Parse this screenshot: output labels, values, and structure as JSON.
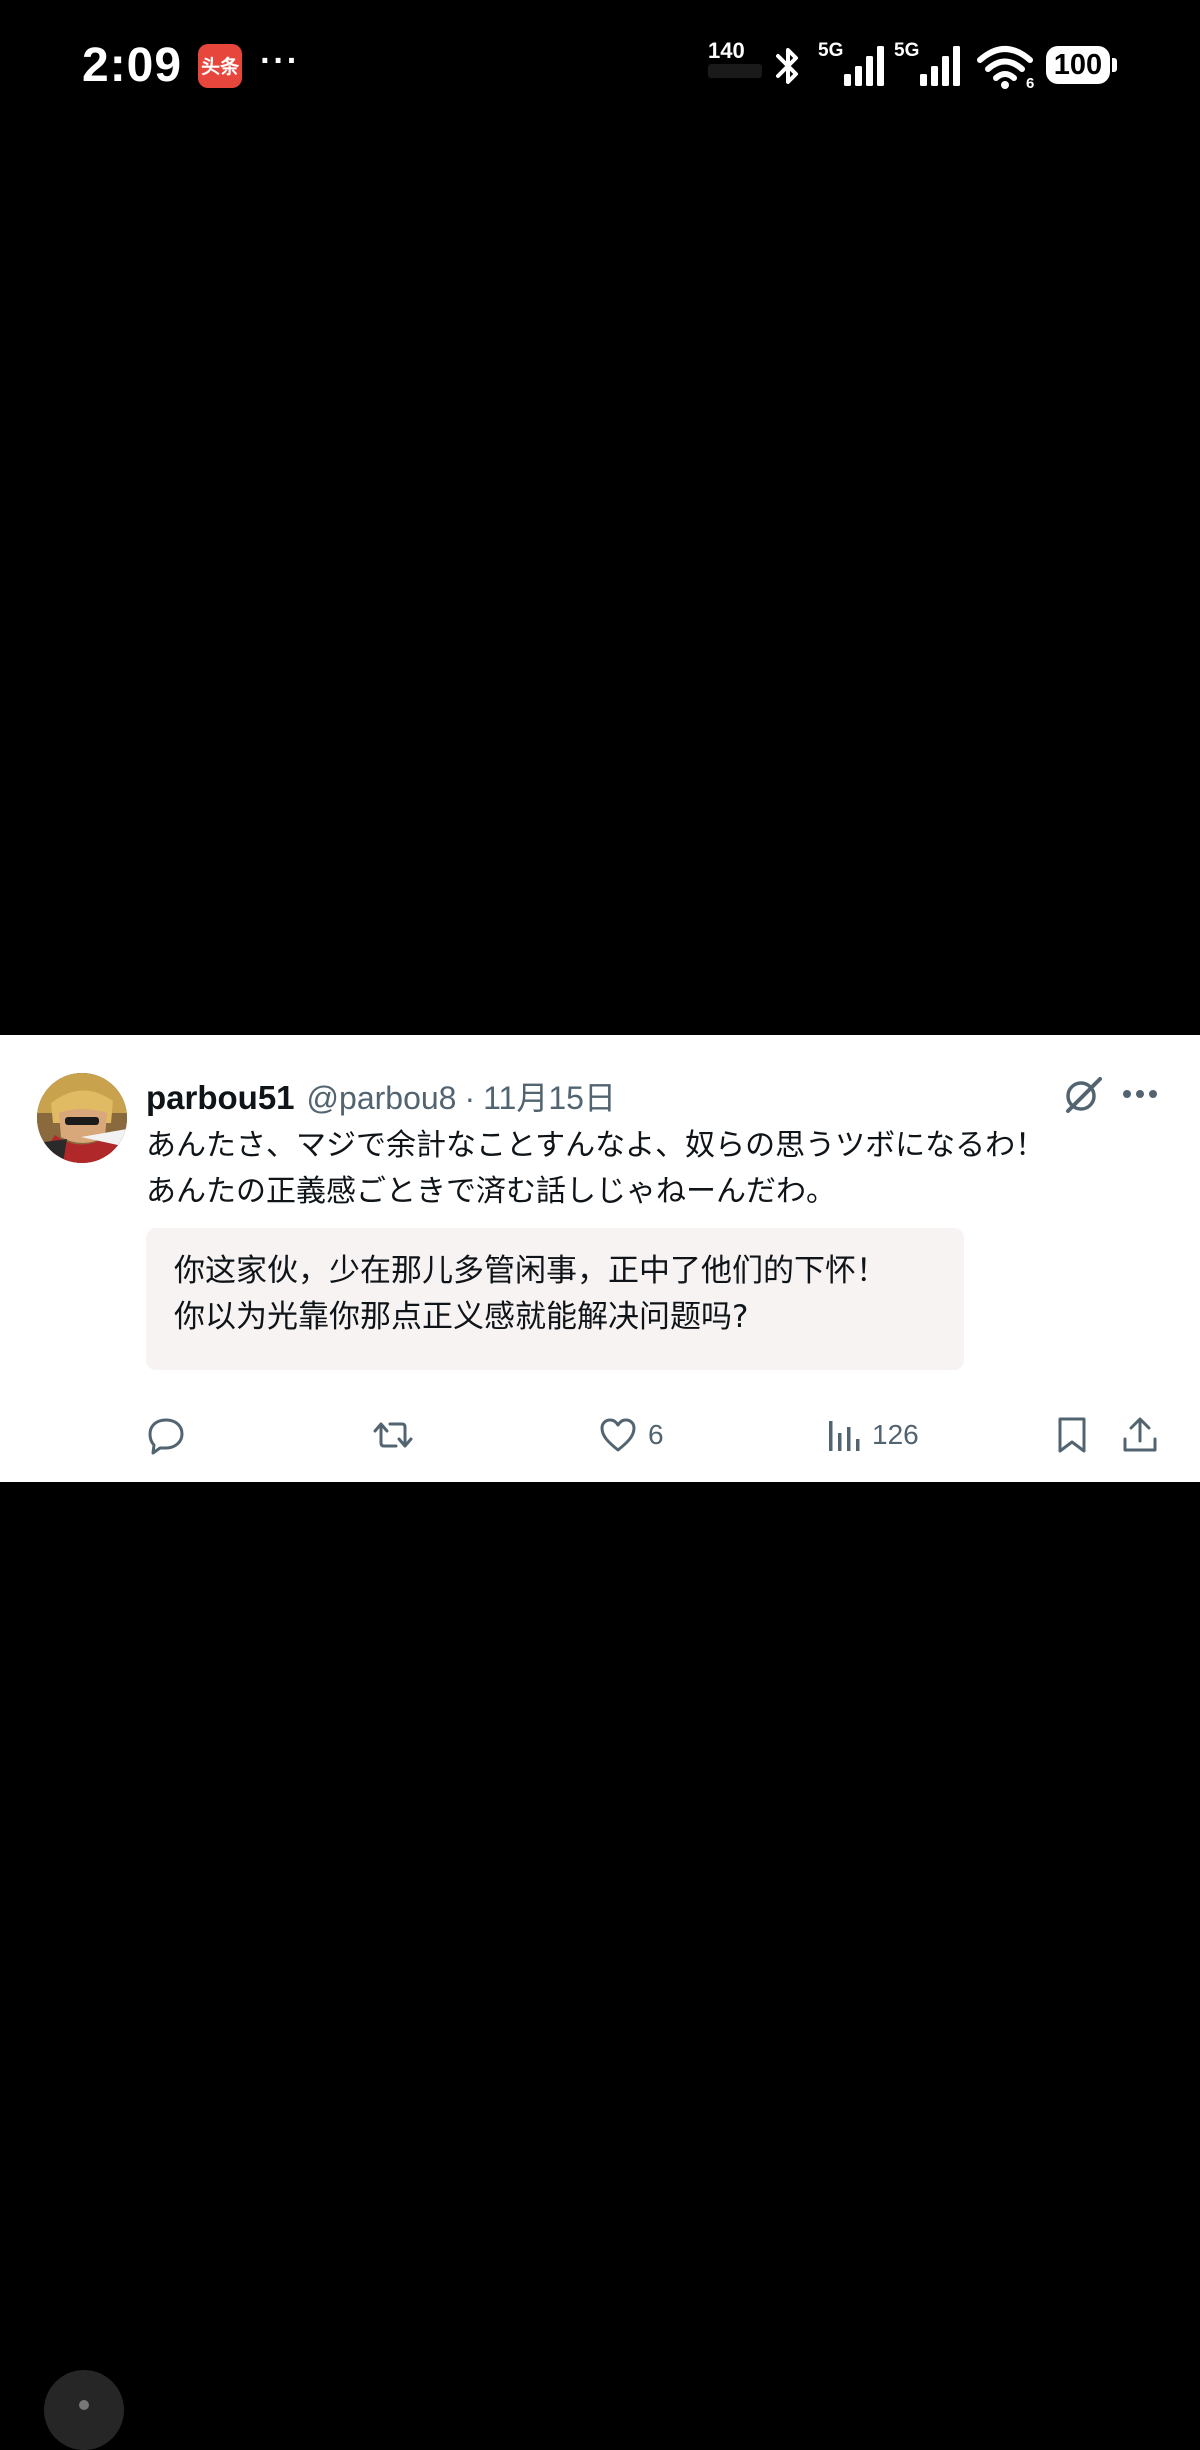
{
  "status_bar": {
    "time": "2:09",
    "app_badge": "头条",
    "more": "···",
    "net_speed": "140",
    "signal_1_label": "5G",
    "signal_2_label": "5G",
    "wifi_label": "6",
    "battery": "100",
    "icons": [
      "bluetooth-icon",
      "signal-icon",
      "signal-icon",
      "wifi-icon",
      "battery-icon"
    ]
  },
  "tweet": {
    "display_name": "parbou51",
    "handle": "@parbou8",
    "separator": "·",
    "date": "11月15日",
    "text_lines": [
      "あんたさ、マジで余計なことすんなよ、奴らの思うツボになるわ！",
      "あんたの正義感ごときで済む話しじゃねーんだわ。"
    ],
    "translation_lines": [
      "你这家伙，少在那儿多管闲事，正中了他们的下怀！",
      "你以为光靠你那点正义感就能解决问题吗?"
    ],
    "actions": {
      "reply_count": "",
      "repost_count": "",
      "like_count": "6",
      "views_count": "126"
    }
  },
  "colors": {
    "background": "#000000",
    "card": "#ffffff",
    "text": "#0f1419",
    "secondary_text": "#536471",
    "translation_bg": "#f7f3f3",
    "app_badge": "#e6463c"
  }
}
